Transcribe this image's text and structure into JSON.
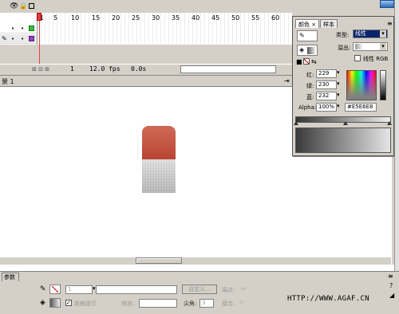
{
  "timeline": {
    "frame_numbers": [
      "1",
      "5",
      "10",
      "15",
      "20",
      "25",
      "30",
      "35",
      "40",
      "45",
      "50",
      "55",
      "60"
    ],
    "status": {
      "frame": "1",
      "fps": "12.0 fps",
      "time": "0.0s"
    }
  },
  "scene": {
    "label": "景 1"
  },
  "mixer": {
    "tabs": [
      "颜色",
      "样本"
    ],
    "type_label": "类型:",
    "type_value": "线性",
    "overflow_label": "溢出:",
    "linear_rgb_label": "线性 RGB",
    "red_label": "红:",
    "red_value": "229",
    "green_label": "绿:",
    "green_value": "230",
    "blue_label": "蓝:",
    "blue_value": "232",
    "alpha_label": "Alpha:",
    "alpha_value": "100%",
    "hex_value": "#E5E6E8"
  },
  "props": {
    "tab": "参数",
    "stroke_value": "1",
    "custom_button": "自定义...",
    "endpoint_label": "端点:",
    "stroke_hint_label": "笔触提示",
    "scale_label": "缩放:",
    "miter_label": "尖角:",
    "miter_value": "3",
    "join_label": "接合:"
  },
  "watermark": "HTTP://WWW.AGAF.CN",
  "colors": {
    "eraser_red": "#c0523e",
    "playhead": "#e04040",
    "ui_gray": "#d4d0c8"
  }
}
